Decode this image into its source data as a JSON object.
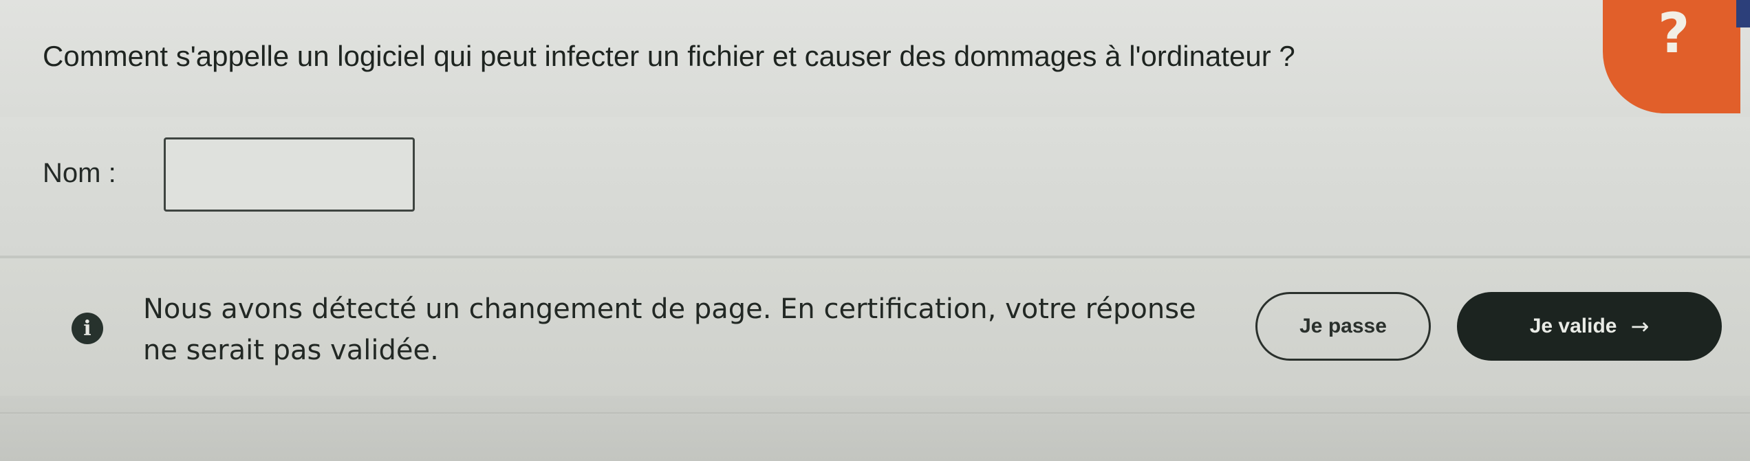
{
  "question": {
    "text": "Comment s'appelle un logiciel qui peut infecter un fichier et causer des dommages à l'ordinateur ?"
  },
  "help": {
    "glyph": "?",
    "icon": "help-question-icon",
    "color": "#e15f2a"
  },
  "form": {
    "name_label": "Nom :",
    "name_value": "",
    "name_placeholder": ""
  },
  "notice": {
    "icon": "info-icon",
    "icon_glyph": "i",
    "text": "Nous avons détecté un changement de page. En certification, votre réponse ne serait pas validée."
  },
  "actions": {
    "skip_label": "Je passe",
    "validate_label": "Je valide",
    "validate_icon": "arrow-right-icon",
    "validate_icon_glyph": "→",
    "primary_color": "#1c2420"
  }
}
